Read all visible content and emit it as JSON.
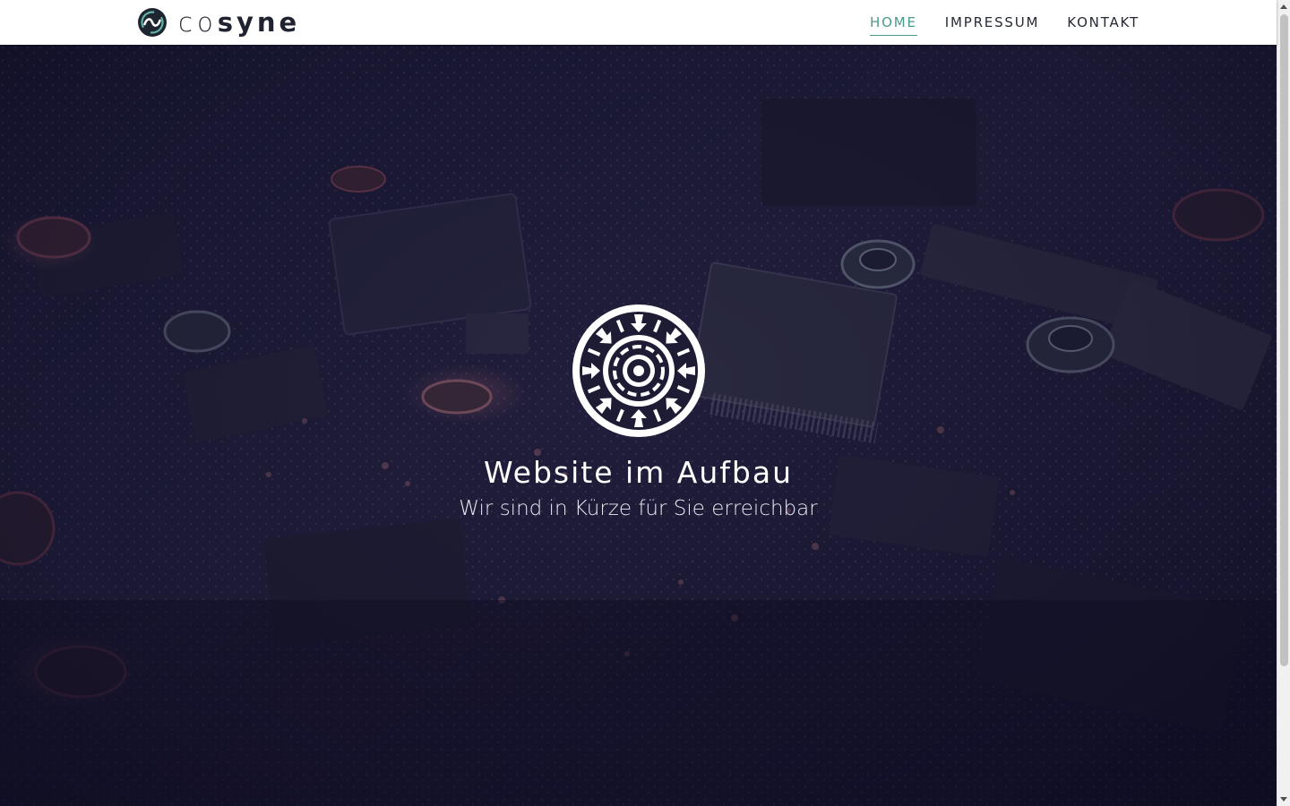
{
  "brand": {
    "name_light": "co",
    "name_bold": "syne",
    "logo_icon": "cosyne-swirl-logo-icon"
  },
  "nav": {
    "items": [
      {
        "label": "HOME",
        "active": true
      },
      {
        "label": "IMPRESSUM",
        "active": false
      },
      {
        "label": "KONTAKT",
        "active": false
      }
    ]
  },
  "hero": {
    "emblem_icon": "circuit-wheel-emblem-icon",
    "title": "Website im Aufbau",
    "subtitle": "Wir sind in Kürze für Sie erreichbar",
    "background": "circuit-board-photo"
  },
  "colors": {
    "accent": "#4a9a8e",
    "nav_text": "#262a36",
    "hero_base": "#14132a",
    "hero_text": "#ffffff"
  }
}
